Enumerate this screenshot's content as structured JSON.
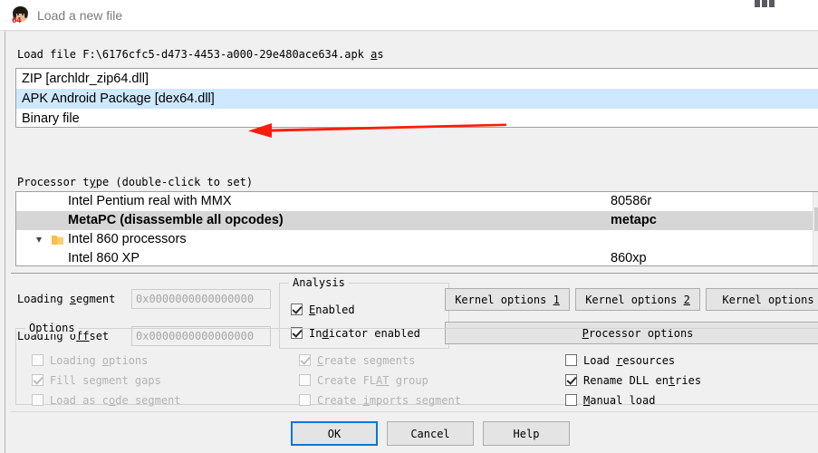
{
  "window": {
    "title": "Load a new file",
    "icon": "ida-logo-icon"
  },
  "load_file": {
    "prefix": "Load file ",
    "path": "F:\\6176cfc5-d473-4453-a000-29e480ace634.apk",
    "suffix_underlined": "a",
    "suffix_rest": "s"
  },
  "loaders": [
    {
      "label": "ZIP [archldr_zip64.dll]",
      "selected": false
    },
    {
      "label": "APK Android Package [dex64.dll]",
      "selected": true
    },
    {
      "label": "Binary file",
      "selected": false
    }
  ],
  "annotation": {
    "type": "red-arrow",
    "color": "#fb1c0c",
    "points_to": "APK Android Package [dex64.dll]"
  },
  "processor": {
    "label_prefix": "Processor t",
    "label_accel": "y",
    "label_suffix": "pe (double-click to set)",
    "rows": [
      {
        "name": "Intel Pentium real with MMX",
        "value": "80586r",
        "selected": false,
        "folder": false,
        "expanded": false
      },
      {
        "name": "MetaPC (disassemble all opcodes)",
        "value": "metapc",
        "selected": true,
        "folder": false,
        "expanded": false
      },
      {
        "name": "Intel 860 processors",
        "value": "",
        "selected": false,
        "folder": true,
        "expanded": true
      },
      {
        "name": "Intel 860 XP",
        "value": "860xp",
        "selected": false,
        "folder": false,
        "expanded": false
      }
    ]
  },
  "loading_segment": {
    "label_prefix": "Loading ",
    "label_accel": "s",
    "label_suffix": "egment",
    "value": "0x0000000000000000"
  },
  "loading_offset": {
    "label_prefix": "Loading o",
    "label_accel": "ff",
    "label_suffix": "set",
    "value": "0x0000000000000000"
  },
  "analysis": {
    "title": "Analysis",
    "items": [
      {
        "prefix": "",
        "accel": "E",
        "suffix": "nabled",
        "checked": true,
        "disabled": false
      },
      {
        "prefix": "In",
        "accel": "d",
        "suffix": "icator enabled",
        "checked": true,
        "disabled": false
      }
    ]
  },
  "kernel_buttons": [
    {
      "prefix": "Kernel options ",
      "accel": "1",
      "suffix": ""
    },
    {
      "prefix": "Kernel options ",
      "accel": "2",
      "suffix": ""
    },
    {
      "prefix": "Kernel options",
      "accel": "",
      "suffix": ""
    }
  ],
  "processor_options_button": {
    "prefix": "",
    "accel": "P",
    "suffix": "rocessor options"
  },
  "options": {
    "title": "Options",
    "column1": [
      {
        "prefix": "Loading ",
        "accel": "o",
        "suffix": "ptions",
        "checked": false,
        "disabled": true
      },
      {
        "prefix": "Fill segment ",
        "accel": "g",
        "suffix": "aps",
        "checked": true,
        "disabled": true
      },
      {
        "prefix": "Load as c",
        "accel": "o",
        "suffix": "de segment",
        "checked": false,
        "disabled": true
      }
    ],
    "column2": [
      {
        "prefix": "",
        "accel": "C",
        "suffix": "reate segments",
        "checked": true,
        "disabled": true
      },
      {
        "prefix": "Create FL",
        "accel": "AT",
        "suffix": " group",
        "checked": false,
        "disabled": true
      },
      {
        "prefix": "Create ",
        "accel": "i",
        "suffix": "mports segment",
        "checked": false,
        "disabled": true
      }
    ],
    "column3": [
      {
        "prefix": "Load ",
        "accel": "r",
        "suffix": "esources",
        "checked": false,
        "disabled": false
      },
      {
        "prefix": "Rename DLL en",
        "accel": "t",
        "suffix": "ries",
        "checked": true,
        "disabled": false
      },
      {
        "prefix": "",
        "accel": "M",
        "suffix": "anual load",
        "checked": false,
        "disabled": false
      }
    ]
  },
  "footer_buttons": [
    {
      "label": "OK",
      "focused": true
    },
    {
      "label": "Cancel",
      "focused": false
    },
    {
      "label": "Help",
      "focused": false
    }
  ],
  "colors": {
    "selection_blue": "#cde8ff",
    "selection_gray": "#d6d6d6",
    "focus_blue": "#0078d7",
    "arrow_red": "#fb1c0c",
    "folder_yellow": "#ffcd6b"
  }
}
